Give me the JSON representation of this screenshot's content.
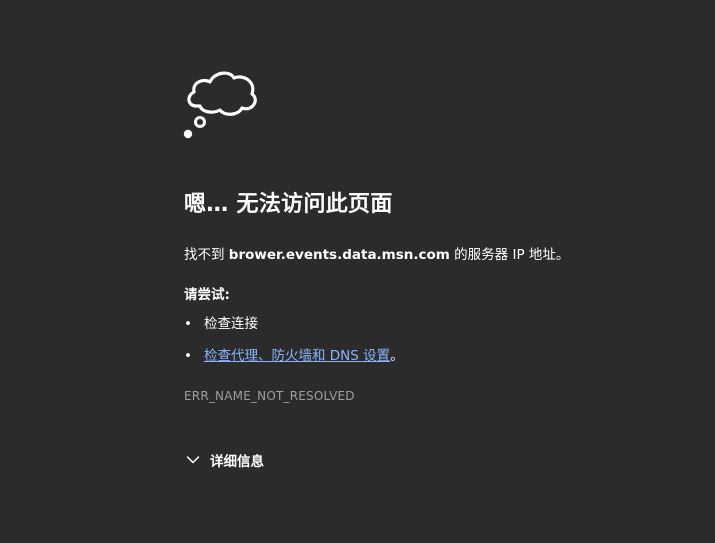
{
  "error": {
    "title": "嗯… 无法访问此页面",
    "message_prefix": "找不到 ",
    "host": "brower.events.data.msn.com",
    "message_suffix": " 的服务器 IP 地址。",
    "try_label": "请尝试:",
    "suggestions": [
      {
        "text": "检查连接",
        "is_link": false
      },
      {
        "text": "检查代理、防火墙和 DNS 设置",
        "is_link": true,
        "suffix": "。"
      }
    ],
    "error_code": "ERR_NAME_NOT_RESOLVED",
    "details_label": "详细信息"
  },
  "colors": {
    "background": "#2b2b2b",
    "text": "#ffffff",
    "link": "#8ab4f8",
    "muted": "#9e9e9e"
  },
  "icons": {
    "cloud": "thought-cloud-icon",
    "chevron": "chevron-down-icon"
  }
}
